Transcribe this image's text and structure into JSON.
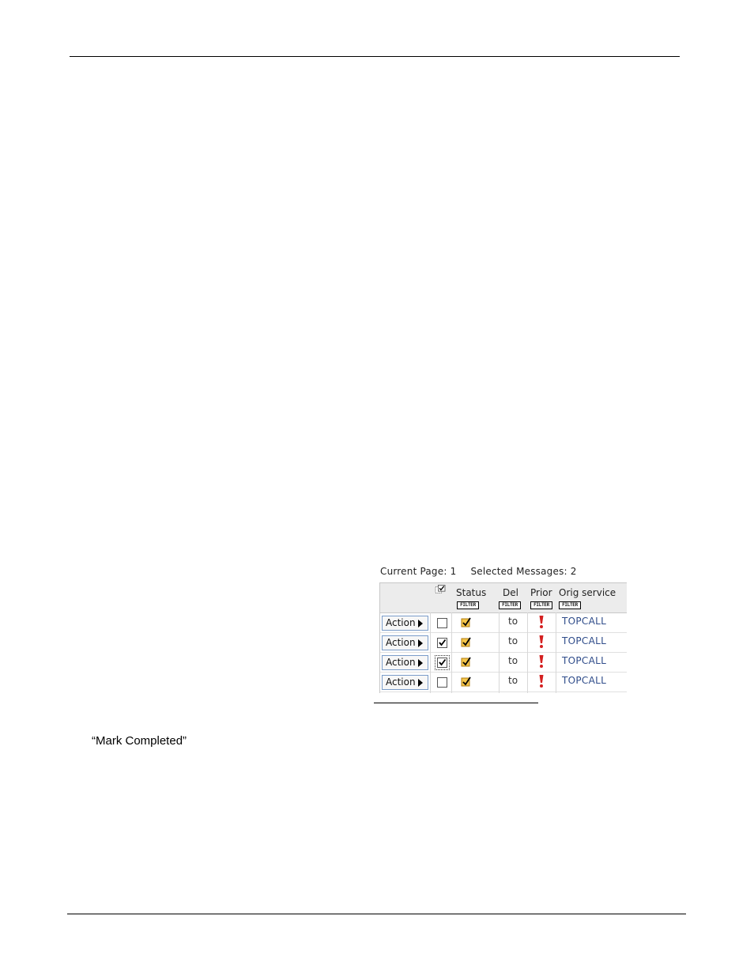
{
  "document": {
    "quote_text": "“Mark Completed”"
  },
  "screenshot": {
    "current_page_label": "Current Page: 1",
    "selected_messages_label": "Selected Messages: 2",
    "columns": {
      "status": "Status",
      "del": "Del",
      "prior": "Prior",
      "orig_service": "Orig service"
    },
    "filter_label": "FILTER",
    "rows": [
      {
        "action": "Action",
        "checked": false,
        "del": "to",
        "orig": "TOPCALL"
      },
      {
        "action": "Action",
        "checked": true,
        "del": "to",
        "orig": "TOPCALL"
      },
      {
        "action": "Action",
        "checked": true,
        "del": "to",
        "orig": "TOPCALL"
      },
      {
        "action": "Action",
        "checked": false,
        "del": "to",
        "orig": "TOPCALL"
      }
    ],
    "colors": {
      "status_check": "#e8a317",
      "priority": "#d42020",
      "orig_link": "#2f4c8a"
    }
  }
}
